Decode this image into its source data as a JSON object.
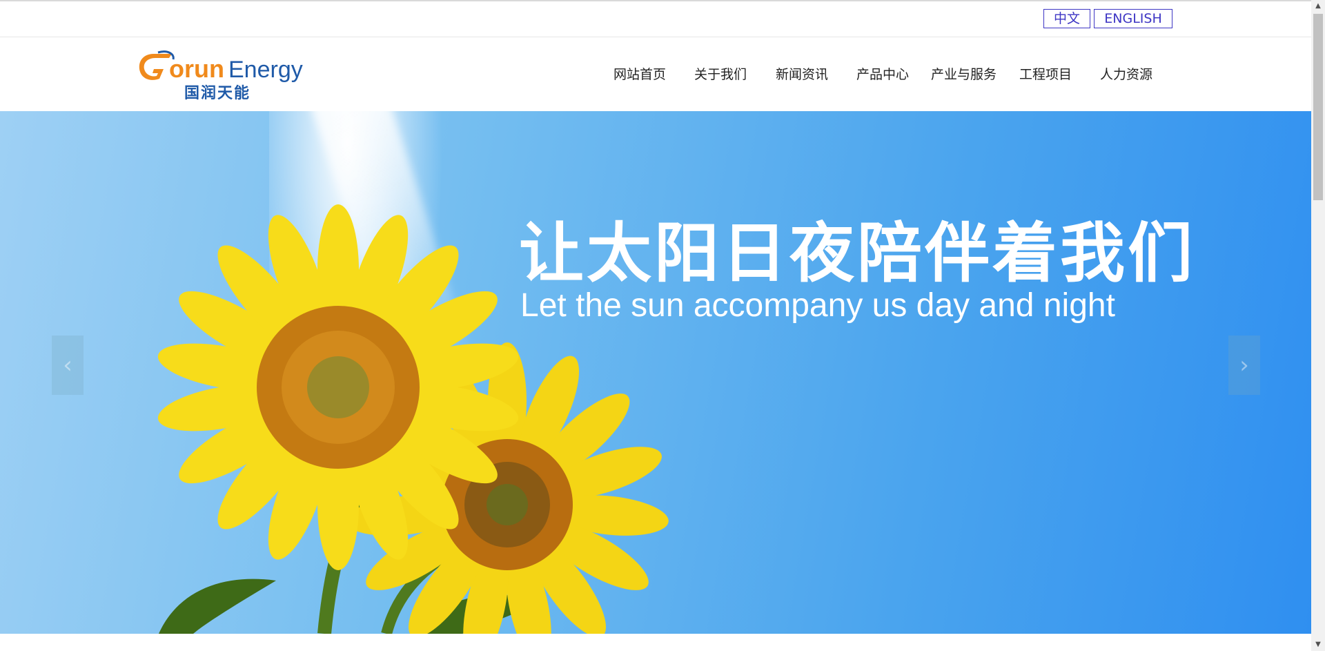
{
  "language_switch": {
    "zh_label": "中文",
    "en_label": "ENGLISH"
  },
  "logo": {
    "brand_en": "GorunEnergy",
    "brand_cn": "国润天能"
  },
  "nav": {
    "items": [
      {
        "label": "网站首页"
      },
      {
        "label": "关于我们"
      },
      {
        "label": "新闻资讯"
      },
      {
        "label": "产品中心"
      },
      {
        "label": "产业与服务"
      },
      {
        "label": "工程项目"
      },
      {
        "label": "人力资源"
      }
    ]
  },
  "banner": {
    "headline_cn": "让太阳日夜陪伴着我们",
    "headline_en": "Let the sun accompany us day and night",
    "prev_icon": "chevron-left-icon",
    "next_icon": "chevron-right-icon",
    "sky_color": "#4aa4ee",
    "petal_color": "#f7dc1a",
    "center_color": "#c47a12"
  },
  "colors": {
    "lang_border": "#3d35c4",
    "logo_orange": "#f08a1c",
    "logo_blue": "#1f5aa8"
  }
}
